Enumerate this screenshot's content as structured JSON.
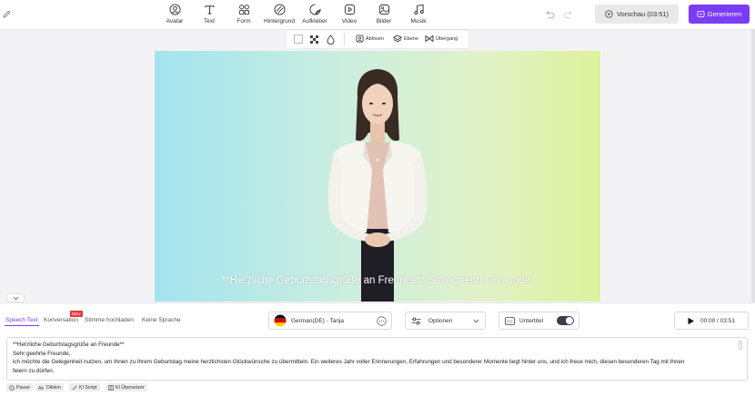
{
  "toolbar": {
    "tools": [
      {
        "label": "Avatar",
        "icon": "avatar-icon"
      },
      {
        "label": "Text",
        "icon": "text-icon"
      },
      {
        "label": "Form",
        "icon": "form-icon"
      },
      {
        "label": "Hintergrund",
        "icon": "background-icon"
      },
      {
        "label": "Aufkleber",
        "icon": "sticker-icon"
      },
      {
        "label": "Video",
        "icon": "video-icon"
      },
      {
        "label": "Bilder",
        "icon": "image-icon"
      },
      {
        "label": "Musik",
        "icon": "music-icon"
      }
    ],
    "preview_label": "Vorschau (03:51)",
    "generate_label": "Generieren"
  },
  "canvas_toolbar": {
    "remove_label": "Ablösen",
    "layer_label": "Ebene",
    "transition_label": "Übergang"
  },
  "canvas": {
    "subtitle": "**Herzliche Geburtstagsgrüße an Freunde** Sehr geehrte Freunde,"
  },
  "panel": {
    "tabs": [
      {
        "label": "Speech Text",
        "active": true
      },
      {
        "label": "Konversation"
      },
      {
        "label": "Stimme hochladen"
      },
      {
        "label": "Keine Sprache"
      }
    ],
    "new_badge": "NEU",
    "voice": "German(DE) - Tanja",
    "options_label": "Optionen",
    "subtitle_label": "Untertitel",
    "subtitle_on": true,
    "time": "00:00 / 03:51",
    "script_lines": [
      "**Herzliche Geburtstagsgrüße an Freunde**",
      "Sehr geehrte Freunde,",
      "ich möchte die Gelegenheit nutzen, um Ihnen zu Ihrem Geburtstag meine herzlichsten Glückwünsche zu übermitteln. Ein weiteres Jahr voller Erinnerungen, Erfahrungen und besonderer Momente liegt hinter uns, und ich freue mich, diesen besonderen Tag mit Ihnen",
      "feiern zu dürfen."
    ],
    "actions": [
      {
        "label": "Pause"
      },
      {
        "label": "Diktion"
      },
      {
        "label": "KI Script"
      },
      {
        "label": "KI Übersetzer"
      }
    ]
  },
  "colors": {
    "accent": "#7b3cf6",
    "badge": "#e5383b"
  }
}
